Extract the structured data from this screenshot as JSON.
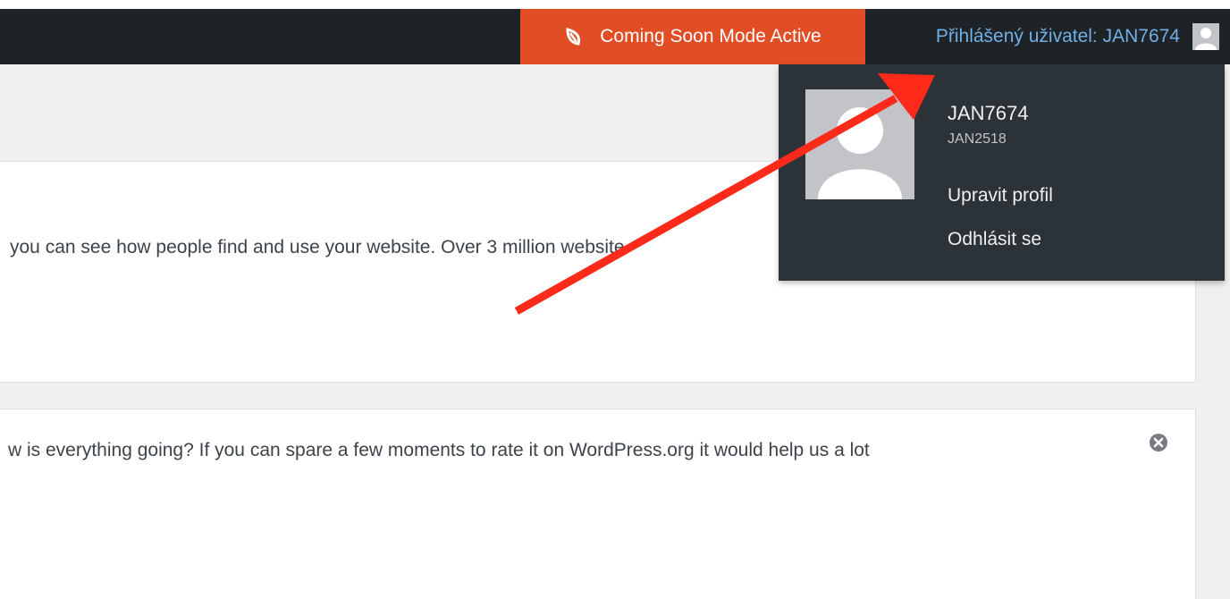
{
  "adminbar": {
    "coming_soon_label": "Coming Soon Mode Active",
    "user_label": "Přihlášený uživatel: JAN7674"
  },
  "notices": [
    {
      "text": "you can see how people find and use your website. Over 3 million website"
    },
    {
      "text": "w is everything going? If you can spare a few moments to rate it on WordPress.org it would help us a lot"
    }
  ],
  "user_menu": {
    "display_name": "JAN7674",
    "username": "JAN2518",
    "edit_profile": "Upravit profil",
    "logout": "Odhlásit se"
  },
  "colors": {
    "adminbar_bg": "#1d2327",
    "coming_soon_bg": "#e14d24",
    "user_link": "#72aee6",
    "dropdown_bg": "#2c3338",
    "annotation_arrow": "#ff2a1a"
  }
}
